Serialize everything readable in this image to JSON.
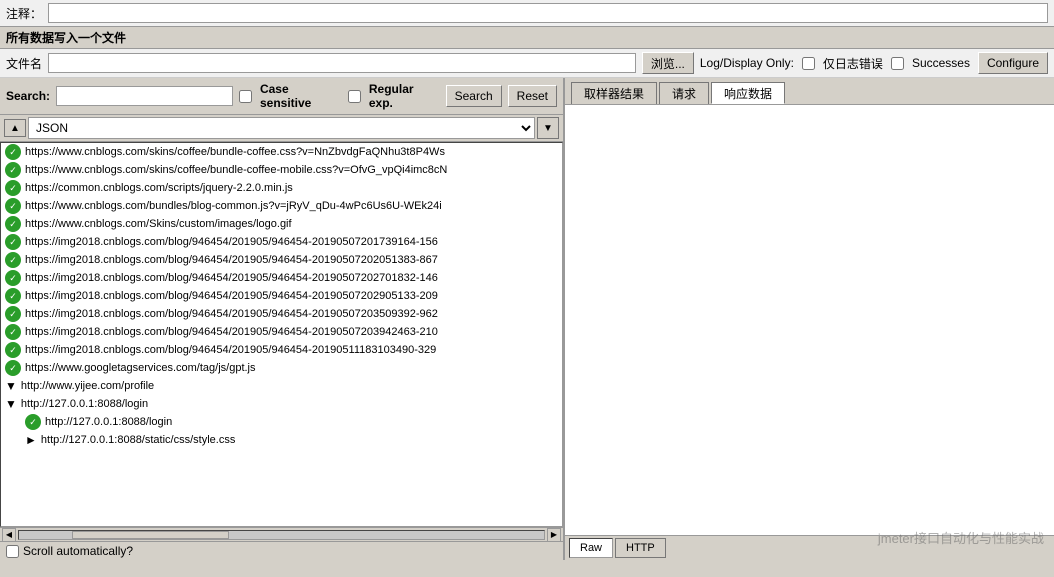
{
  "top": {
    "comment_label": "注释：",
    "section_title": "所有数据写入一个文件",
    "filename_label": "文件名",
    "browse_btn": "浏览...",
    "log_display_label": "Log/Display Only:",
    "log_errors_label": "仅日志错误",
    "successes_label": "Successes",
    "configure_btn": "Configure"
  },
  "search": {
    "label": "Search:",
    "placeholder": "",
    "case_sensitive_label": "Case sensitive",
    "regular_exp_label": "Regular exp.",
    "search_btn": "Search",
    "reset_btn": "Reset"
  },
  "dropdown": {
    "selected": "JSON"
  },
  "urls": [
    {
      "indent": 0,
      "type": "check",
      "text": "https://www.cnblogs.com/skins/coffee/bundle-coffee.css?v=NnZbvdgFaQNhu3t8P4Ws"
    },
    {
      "indent": 0,
      "type": "check",
      "text": "https://www.cnblogs.com/skins/coffee/bundle-coffee-mobile.css?v=OfvG_vpQi4imc8cN"
    },
    {
      "indent": 0,
      "type": "check",
      "text": "https://common.cnblogs.com/scripts/jquery-2.2.0.min.js"
    },
    {
      "indent": 0,
      "type": "check",
      "text": "https://www.cnblogs.com/bundles/blog-common.js?v=jRyV_qDu-4wPc6Us6U-WEk24i"
    },
    {
      "indent": 0,
      "type": "check",
      "text": "https://www.cnblogs.com/Skins/custom/images/logo.gif"
    },
    {
      "indent": 0,
      "type": "check",
      "text": "https://img2018.cnblogs.com/blog/946454/201905/946454-20190507201739164-156"
    },
    {
      "indent": 0,
      "type": "check",
      "text": "https://img2018.cnblogs.com/blog/946454/201905/946454-20190507202051383-867"
    },
    {
      "indent": 0,
      "type": "check",
      "text": "https://img2018.cnblogs.com/blog/946454/201905/946454-20190507202701832-146"
    },
    {
      "indent": 0,
      "type": "check",
      "text": "https://img2018.cnblogs.com/blog/946454/201905/946454-20190507202905133-209"
    },
    {
      "indent": 0,
      "type": "check",
      "text": "https://img2018.cnblogs.com/blog/946454/201905/946454-20190507203509392-962"
    },
    {
      "indent": 0,
      "type": "check",
      "text": "https://img2018.cnblogs.com/blog/946454/201905/946454-20190507203942463-210"
    },
    {
      "indent": 0,
      "type": "check",
      "text": "https://img2018.cnblogs.com/blog/946454/201905/946454-20190511183103490-329"
    },
    {
      "indent": 0,
      "type": "check",
      "text": "https://www.googletagservices.com/tag/js/gpt.js"
    },
    {
      "indent": 0,
      "type": "folder-open",
      "text": "http://www.yijee.com/profile"
    },
    {
      "indent": 0,
      "type": "folder-open",
      "text": "http://127.0.0.1:8088/login"
    },
    {
      "indent": 1,
      "type": "check",
      "text": "http://127.0.0.1:8088/login"
    },
    {
      "indent": 1,
      "type": "folder-partial",
      "text": "http://127.0.0.1:8088/static/css/style.css"
    }
  ],
  "scroll_auto_label": "Scroll automatically?",
  "right_tabs": {
    "tab1": "取样器结果",
    "tab2": "请求",
    "tab3": "响应数据"
  },
  "bottom_btns": {
    "raw": "Raw",
    "http": "HTTP"
  },
  "watermark": "jmeter接口自动化与性能实战"
}
